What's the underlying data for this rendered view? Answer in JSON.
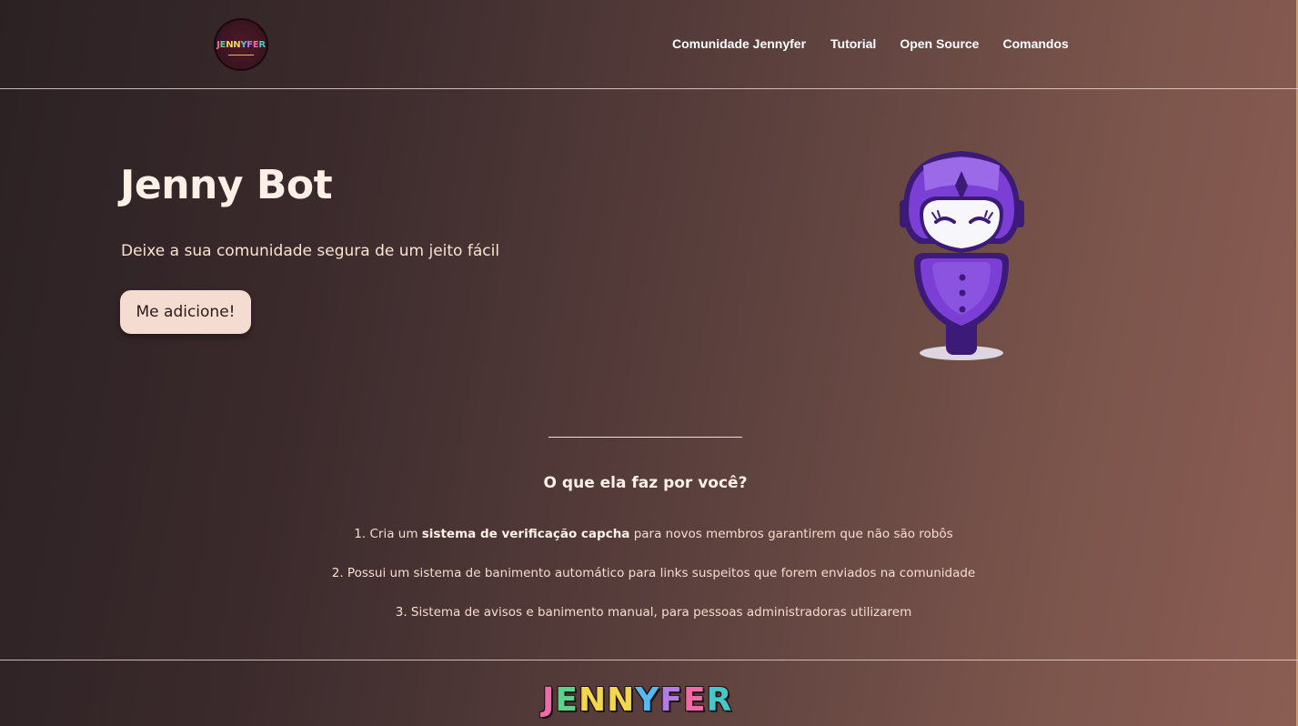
{
  "header": {
    "logo_text": "JENNYFER",
    "nav": [
      {
        "label": "Comunidade Jennyfer"
      },
      {
        "label": "Tutorial"
      },
      {
        "label": "Open Source"
      },
      {
        "label": "Comandos"
      }
    ]
  },
  "hero": {
    "title": "Jenny Bot",
    "subtitle": "Deixe a sua comunidade segura de um jeito fácil",
    "cta_label": "Me adicione!"
  },
  "features": {
    "title": "O que ela faz por você?",
    "items": [
      {
        "prefix": "1. Cria um ",
        "bold": "sistema de verificação capcha",
        "suffix": " para novos membros garantirem que não são robôs"
      },
      {
        "text": "2. Possui um sistema de banimento automático para links suspeitos que forem enviados na comunidade"
      },
      {
        "text": "3. Sistema de avisos e banimento manual, para pessoas administradoras utilizarem"
      }
    ]
  },
  "footer": {
    "logo_letters": [
      "J",
      "E",
      "N",
      "N",
      "Y",
      "F",
      "E",
      "R"
    ],
    "logo_colors": [
      "#f06aa8",
      "#5fd08a",
      "#f2d74c",
      "#f2d74c",
      "#58b8f0",
      "#b47ae8",
      "#f06aa8",
      "#47c7c7"
    ]
  },
  "colors": {
    "accent_button": "#f4ddd0",
    "robot_purple": "#7b3fd6"
  }
}
